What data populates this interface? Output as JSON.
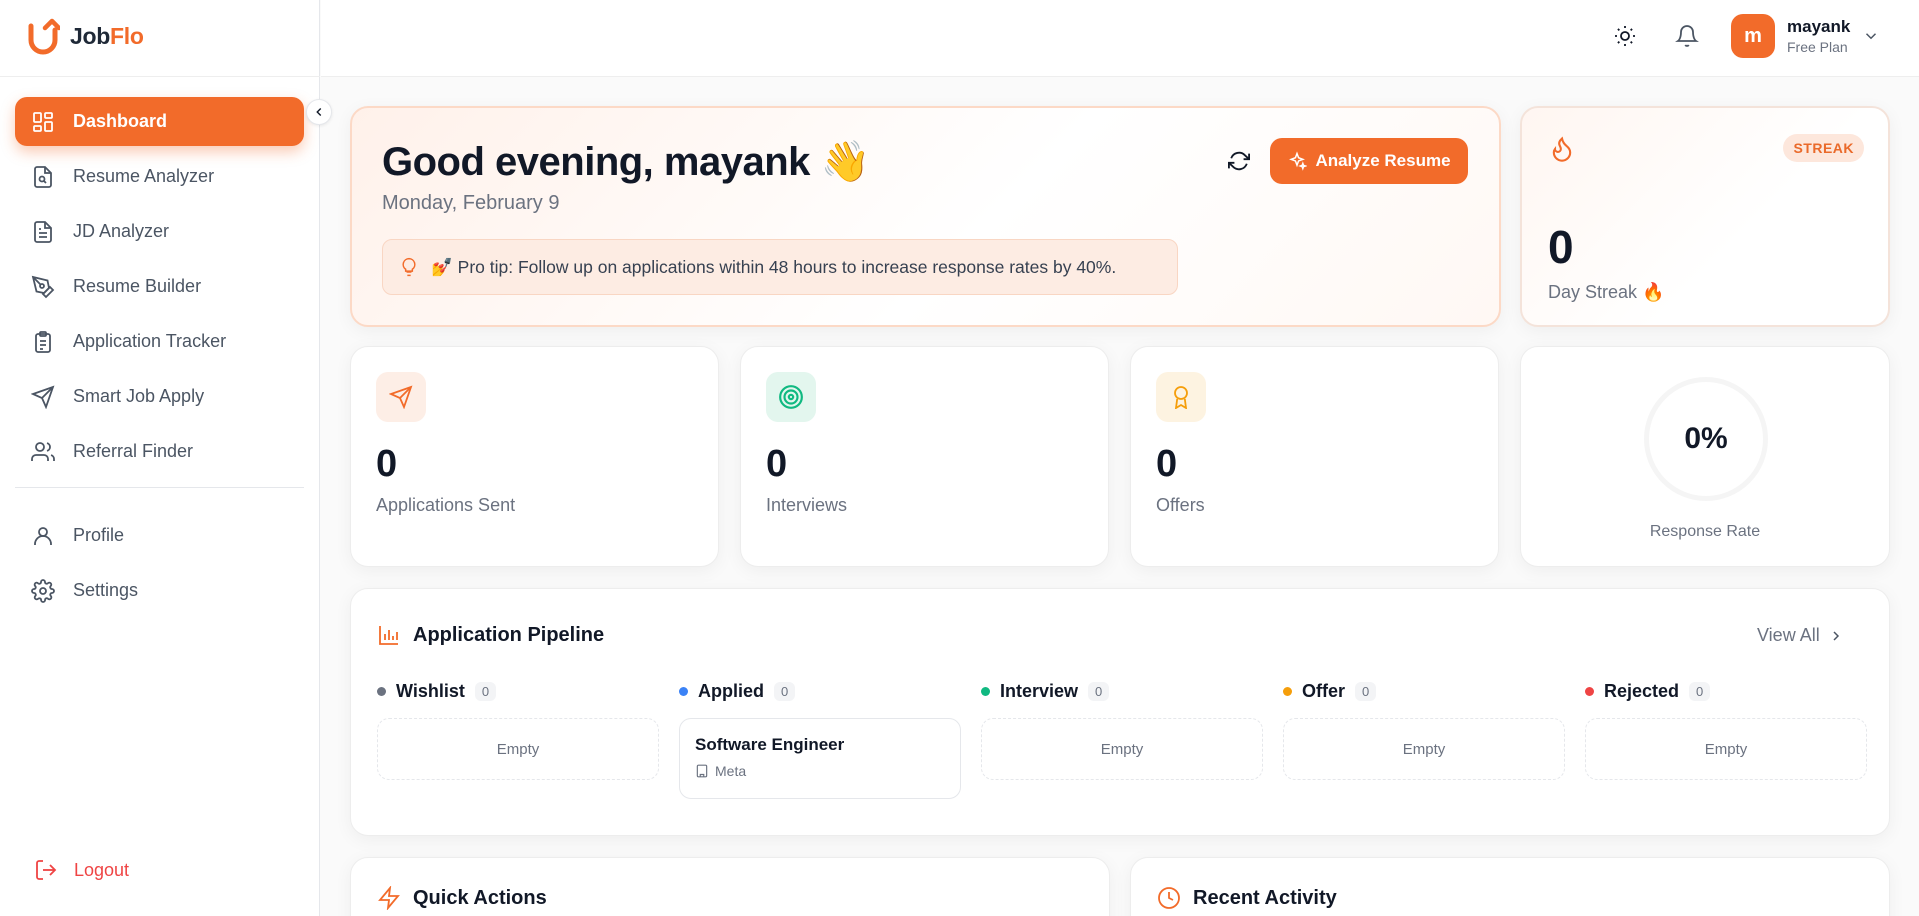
{
  "app": {
    "logo_primary": "Job",
    "logo_accent": "Flo",
    "accent_color": "#f26b2a"
  },
  "sidebar": {
    "items": [
      {
        "label": "Dashboard",
        "icon": "dashboard-icon",
        "active": true
      },
      {
        "label": "Resume Analyzer",
        "icon": "file-search-icon"
      },
      {
        "label": "JD Analyzer",
        "icon": "file-text-icon"
      },
      {
        "label": "Resume Builder",
        "icon": "pen-tool-icon"
      },
      {
        "label": "Application Tracker",
        "icon": "clipboard-icon"
      },
      {
        "label": "Smart Job Apply",
        "icon": "send-icon"
      },
      {
        "label": "Referral Finder",
        "icon": "users-icon"
      }
    ],
    "secondary": [
      {
        "label": "Profile",
        "icon": "user-icon"
      },
      {
        "label": "Settings",
        "icon": "gear-icon"
      }
    ],
    "logout_label": "Logout"
  },
  "header": {
    "user": {
      "initial": "m",
      "name": "mayank",
      "plan": "Free Plan"
    }
  },
  "hero": {
    "greeting": "Good evening, mayank 👋",
    "date": "Monday, February 9",
    "tip": "💅 Pro tip: Follow up on applications within 48 hours to increase response rates by 40%.",
    "analyze_label": "Analyze Resume"
  },
  "streak": {
    "badge": "STREAK",
    "value": "0",
    "label": "Day Streak 🔥"
  },
  "stats": [
    {
      "value": "0",
      "label": "Applications Sent",
      "icon": "send-icon",
      "color": "#f26b2a",
      "bg": "#fdeee6"
    },
    {
      "value": "0",
      "label": "Interviews",
      "icon": "target-icon",
      "color": "#10b981",
      "bg": "#e3f6ee"
    },
    {
      "value": "0",
      "label": "Offers",
      "icon": "award-icon",
      "color": "#f59e0b",
      "bg": "#fdf3e1"
    }
  ],
  "response_rate": {
    "value": "0%",
    "label": "Response Rate"
  },
  "pipeline": {
    "title": "Application Pipeline",
    "view_all": "View All",
    "columns": [
      {
        "name": "Wishlist",
        "count": "0",
        "color": "#6b7280",
        "empty": "Empty"
      },
      {
        "name": "Applied",
        "count": "0",
        "color": "#3b82f6",
        "job": {
          "title": "Software Engineer",
          "company": "Meta"
        }
      },
      {
        "name": "Interview",
        "count": "0",
        "color": "#10b981",
        "empty": "Empty"
      },
      {
        "name": "Offer",
        "count": "0",
        "color": "#f59e0b",
        "empty": "Empty"
      },
      {
        "name": "Rejected",
        "count": "0",
        "color": "#ef4444",
        "empty": "Empty"
      }
    ]
  },
  "quick_actions": {
    "title": "Quick Actions"
  },
  "recent_activity": {
    "title": "Recent Activity"
  }
}
